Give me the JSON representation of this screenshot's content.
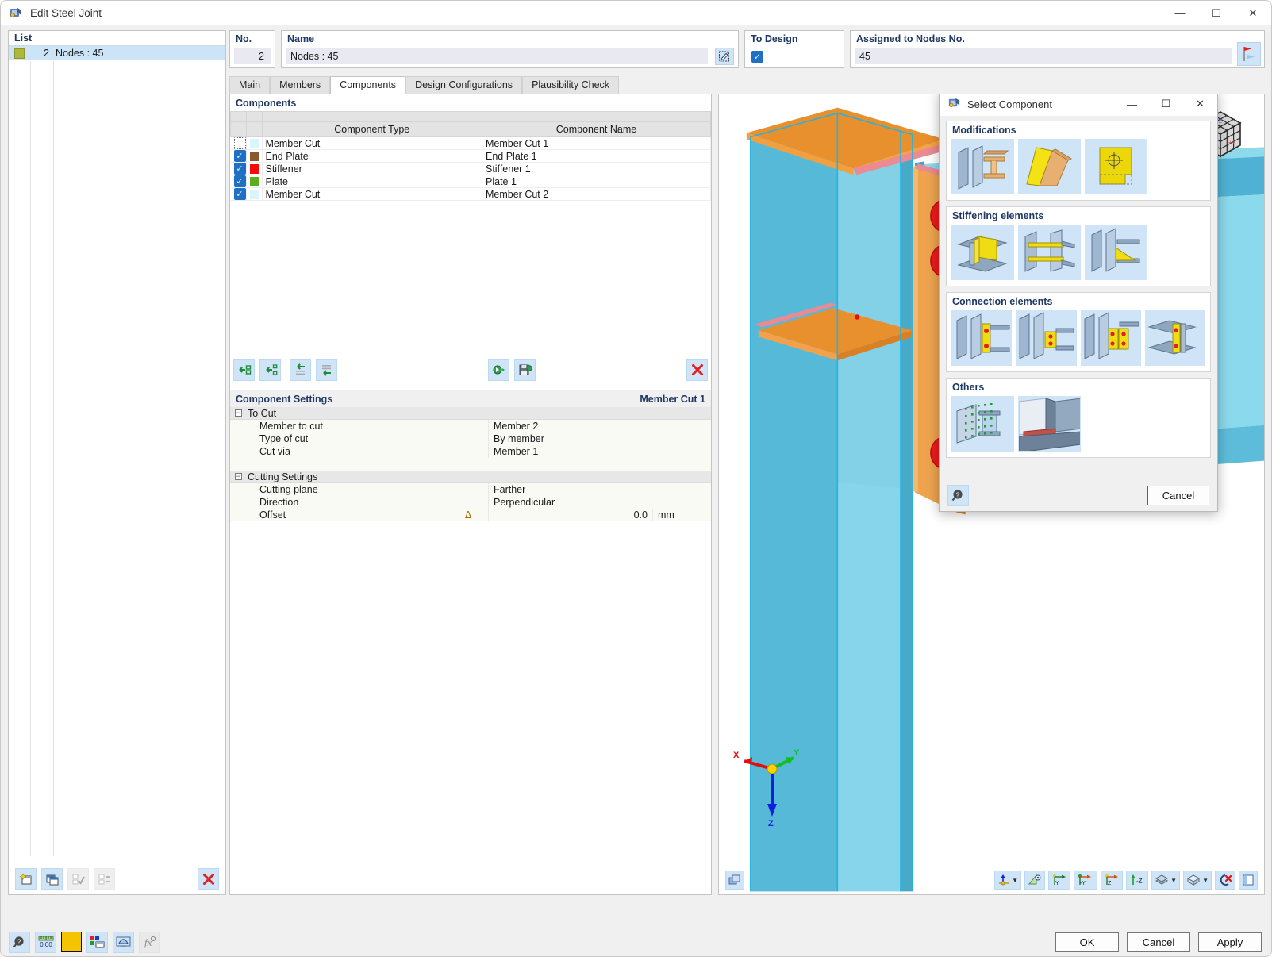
{
  "window": {
    "title": "Edit Steel Joint",
    "icon": "steel-joint-icon",
    "minimize": "—",
    "maximize": "☐",
    "close": "✕"
  },
  "list_panel": {
    "header": "List",
    "items": [
      {
        "color": "#aeb83a",
        "number": "2",
        "label": "Nodes : 45"
      }
    ]
  },
  "header": {
    "no_label": "No.",
    "no_value": "2",
    "name_label": "Name",
    "name_value": "Nodes : 45",
    "to_design_label": "To Design",
    "to_design_checked": true,
    "assigned_label": "Assigned to Nodes No.",
    "assigned_value": "45"
  },
  "tabs": [
    {
      "label": "Main",
      "active": false
    },
    {
      "label": "Members",
      "active": false
    },
    {
      "label": "Components",
      "active": true
    },
    {
      "label": "Design Configurations",
      "active": false
    },
    {
      "label": "Plausibility Check",
      "active": false
    }
  ],
  "components": {
    "section_title": "Components",
    "columns": [
      "Component Type",
      "Component Name"
    ],
    "rows": [
      {
        "checked": false,
        "color": "#d8f6fb",
        "type": "Member Cut",
        "name": "Member Cut 1"
      },
      {
        "checked": true,
        "color": "#8b5a2b",
        "type": "End Plate",
        "name": "End Plate 1"
      },
      {
        "checked": true,
        "color": "#f60b0b",
        "type": "Stiffener",
        "name": "Stiffener 1"
      },
      {
        "checked": true,
        "color": "#5aaf1e",
        "type": "Plate",
        "name": "Plate 1"
      },
      {
        "checked": true,
        "color": "#d8f6fb",
        "type": "Member Cut",
        "name": "Member Cut 2"
      }
    ],
    "toolbar": [
      "insert-component-icon",
      "insert-component-before-icon",
      "move-up-icon",
      "move-down-icon",
      "import-component-icon",
      "export-component-icon",
      "delete-component-icon"
    ]
  },
  "component_settings": {
    "title": "Component Settings",
    "subject": "Member Cut 1",
    "groups": [
      {
        "name": "To Cut",
        "expander": "−",
        "rows": [
          {
            "label": "Member to cut",
            "symbol": "",
            "value": "Member 2",
            "number": "",
            "unit": ""
          },
          {
            "label": "Type of cut",
            "symbol": "",
            "value": "By member",
            "number": "",
            "unit": ""
          },
          {
            "label": "Cut via",
            "symbol": "",
            "value": "Member 1",
            "number": "",
            "unit": ""
          }
        ]
      },
      {
        "name": "Cutting Settings",
        "expander": "−",
        "rows": [
          {
            "label": "Cutting plane",
            "symbol": "",
            "value": "Farther",
            "number": "",
            "unit": ""
          },
          {
            "label": "Direction",
            "symbol": "",
            "value": "Perpendicular",
            "number": "",
            "unit": ""
          },
          {
            "label": "Offset",
            "symbol": "Δ",
            "value": "",
            "number": "0.0",
            "unit": "mm"
          }
        ]
      }
    ]
  },
  "dialog": {
    "title": "Select Component",
    "icon": "steel-joint-icon",
    "minimize": "—",
    "maximize": "☐",
    "close": "✕",
    "groups": [
      {
        "title": "Modifications",
        "thumbs": [
          "member-cut-thumb",
          "chamfer-thumb",
          "opening-thumb"
        ]
      },
      {
        "title": "Stiffening elements",
        "thumbs": [
          "stiffener-thumb",
          "web-stiffener-thumb",
          "haunch-thumb"
        ]
      },
      {
        "title": "Connection elements",
        "thumbs": [
          "end-plate-thumb",
          "fin-plate-thumb",
          "bolted-plate-thumb",
          "angle-cleat-thumb"
        ]
      },
      {
        "title": "Others",
        "thumbs": [
          "surface-mesh-thumb",
          "weld-thumb"
        ]
      }
    ],
    "help_icon": "help-icon",
    "cancel_label": "Cancel"
  },
  "viewport": {
    "nav_cube": "navigation-cube-icon",
    "axes": {
      "x": "X",
      "y": "Y",
      "z": "Z"
    },
    "corner_button": "render-mode-icon",
    "toolbar": [
      "workplane-icon",
      "view-direction-icon",
      "view-x-icon",
      "view-negative-y-icon",
      "view-z-icon",
      "view-negative-z-icon",
      "render-style-icon",
      "display-box-icon",
      "deselect-icon",
      "detach-view-icon"
    ]
  },
  "bottom_bar": {
    "left_icons": [
      "help-icon",
      "decimal-places-icon",
      "color-swatch-icon",
      "display-properties-icon",
      "visual-settings-icon",
      "formula-icon"
    ],
    "buttons": [
      {
        "label": "OK",
        "primary": true
      },
      {
        "label": "Cancel",
        "primary": false
      },
      {
        "label": "Apply",
        "primary": false
      }
    ]
  }
}
